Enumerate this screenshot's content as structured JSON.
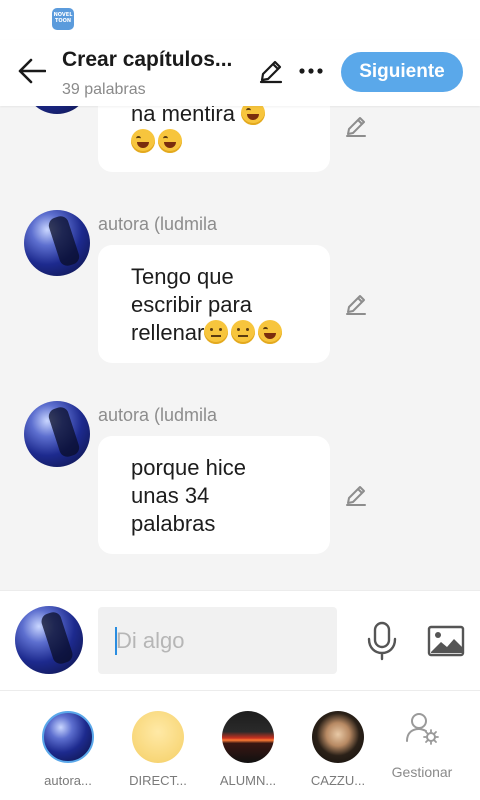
{
  "header": {
    "app_badge": "NOVEL TOON",
    "title": "Crear capítulos...",
    "subtitle": "39 palabras",
    "next_label": "Siguiente"
  },
  "chat": {
    "messages": [
      {
        "author": "",
        "text": "na   mentira",
        "emojis": [
          "laugh",
          "laugh",
          "laugh"
        ]
      },
      {
        "author": "autora (ludmila",
        "text": "Tengo que escribir para rellenar",
        "emojis": [
          "sad",
          "sad",
          "laugh"
        ]
      },
      {
        "author": "autora (ludmila",
        "text": "porque hice unas 34 palabras",
        "emojis": []
      }
    ]
  },
  "input": {
    "placeholder": "Di algo"
  },
  "characters": [
    {
      "name": "autora..."
    },
    {
      "name": "DIRECT..."
    },
    {
      "name": "ALUMN..."
    },
    {
      "name": "CAZZU..."
    }
  ],
  "manage_label": "Gestionar",
  "colors": {
    "accent": "#5aa8ea",
    "background": "#f4f4f4",
    "bubble": "#ffffff"
  }
}
